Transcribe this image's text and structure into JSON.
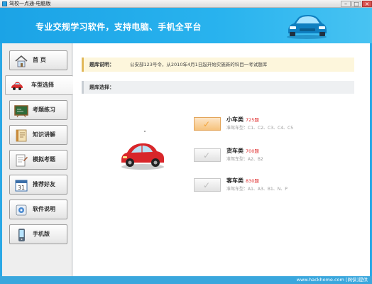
{
  "window": {
    "title": "驾校一点通-电脑版",
    "minimize": "–",
    "maximize": "□",
    "close": "×"
  },
  "banner": {
    "slogan": "专业交规学习软件，支持电脑、手机全平台"
  },
  "sidebar": {
    "items": [
      {
        "label": "首  页",
        "icon": "home-icon",
        "active": false
      },
      {
        "label": "车型选择",
        "icon": "car-icon",
        "active": true
      },
      {
        "label": "考题练习",
        "icon": "blackboard-icon",
        "active": false
      },
      {
        "label": "知识讲解",
        "icon": "book-icon",
        "active": false
      },
      {
        "label": "模拟考题",
        "icon": "exam-paper-icon",
        "active": false
      },
      {
        "label": "推荐好友",
        "icon": "calendar-icon",
        "active": false
      },
      {
        "label": "软件说明",
        "icon": "manual-icon",
        "active": false
      },
      {
        "label": "手机版",
        "icon": "mobile-phone-icon",
        "active": false
      }
    ]
  },
  "notice": {
    "label": "题库说明：",
    "text": "公安部123号令，从2010年4月1日起开始实施新的科目一考试题库"
  },
  "section": {
    "label": "题库选择："
  },
  "options": [
    {
      "name": "小车类",
      "count": "725题",
      "models": "准驾车型：C1、C2、C3、C4、C5",
      "selected": true
    },
    {
      "name": "货车类",
      "count": "700题",
      "models": "准驾车型：A2、B2",
      "selected": false
    },
    {
      "name": "客车类",
      "count": "830题",
      "models": "准驾车型：A1、A3、B1、N、P",
      "selected": false
    }
  ],
  "footer": {
    "watermark": "www.hackhome.com [网侠]提供"
  },
  "colors": {
    "accent": "#2aa8e6",
    "banner": "#1ba3e6",
    "highlight": "#f4a53b",
    "count": "#e03030"
  }
}
